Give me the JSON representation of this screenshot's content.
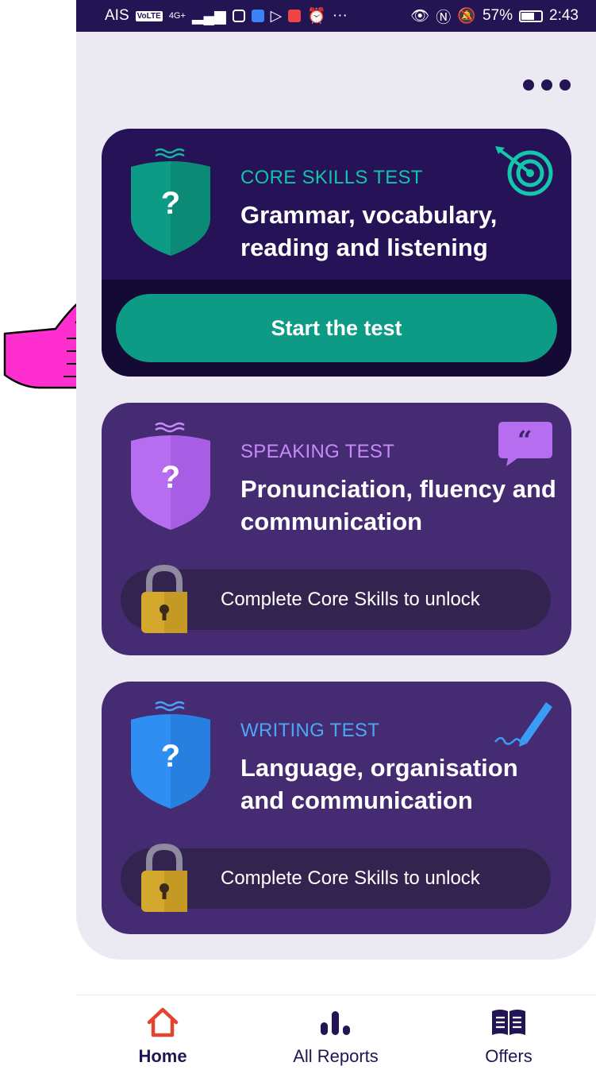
{
  "status_bar": {
    "carrier": "AIS",
    "volte": "VoLTE",
    "network": "4G+",
    "more": "···",
    "battery": "57%",
    "time": "2:43"
  },
  "cards": [
    {
      "category": "CORE SKILLS TEST",
      "title": "Grammar, vocabulary, reading and listening",
      "action_label": "Start the test",
      "icon": "target-icon",
      "color": "#0d9b85"
    },
    {
      "category": "SPEAKING TEST",
      "title": "Pronunciation, fluency and communication",
      "lock_label": "Complete Core Skills to unlock",
      "icon": "speech-quote-icon",
      "color": "#b66df0"
    },
    {
      "category": "WRITING TEST",
      "title": "Language, organisation and communication",
      "lock_label": "Complete Core Skills to unlock",
      "icon": "pen-icon",
      "color": "#2e8ef2"
    }
  ],
  "shield_mark": "?",
  "tabs": [
    {
      "label": "Home",
      "icon": "home-icon",
      "active": true,
      "color": "#e4442f"
    },
    {
      "label": "All Reports",
      "icon": "bar-chart-icon",
      "active": false
    },
    {
      "label": "Offers",
      "icon": "book-icon",
      "active": false
    }
  ]
}
